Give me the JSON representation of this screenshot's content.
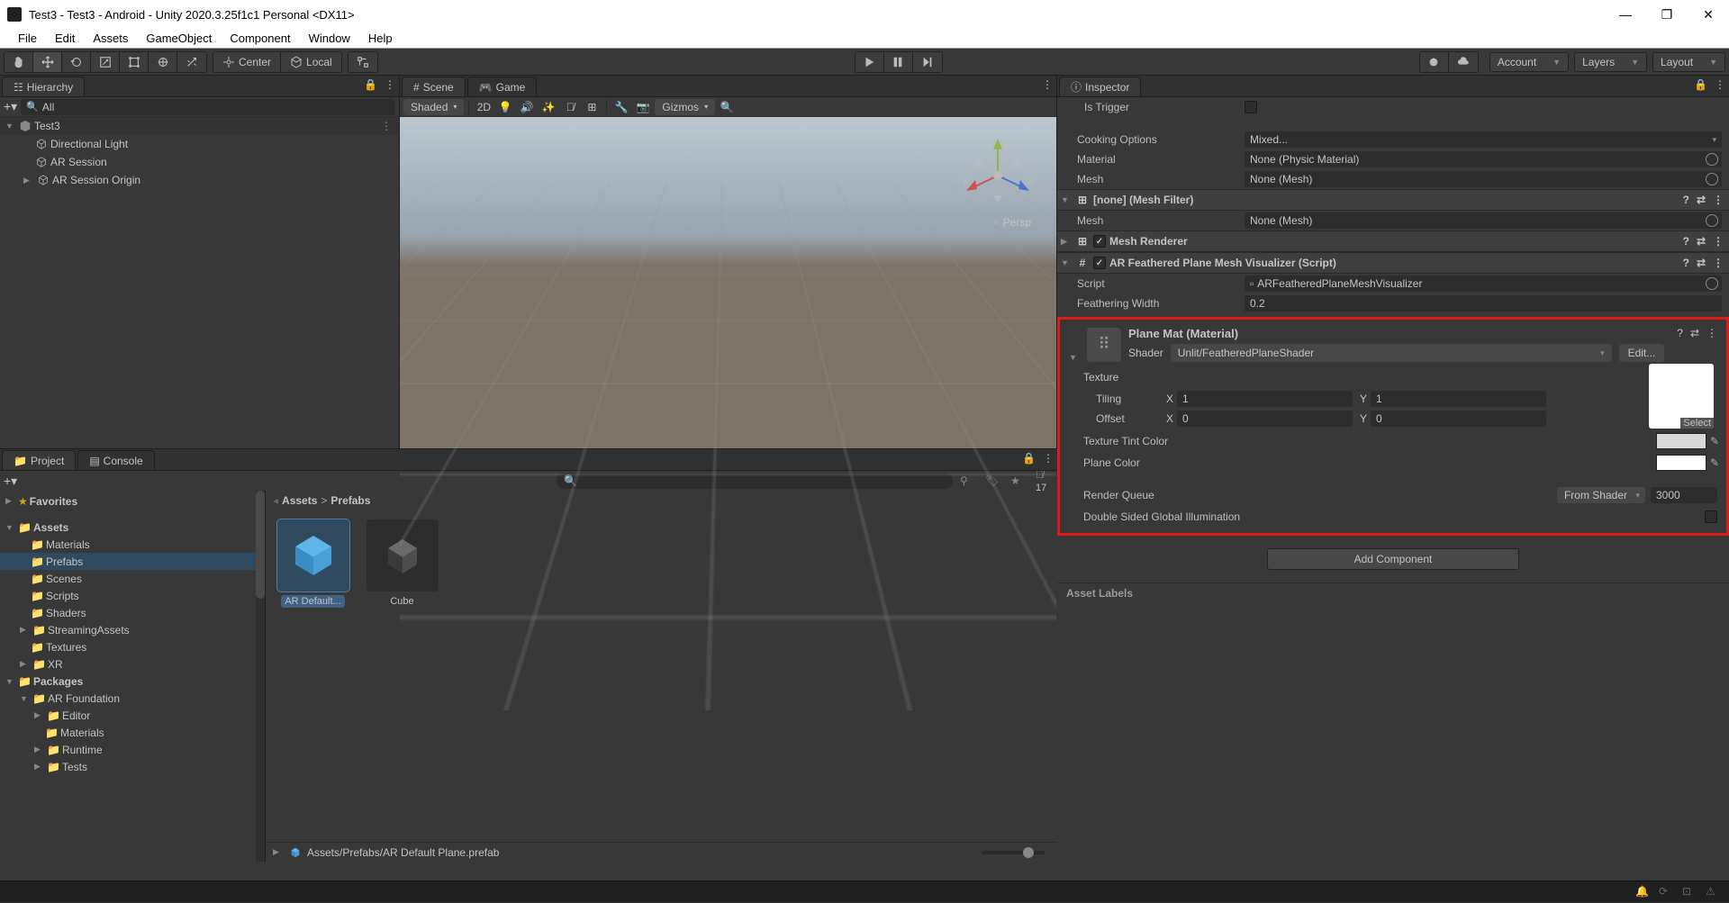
{
  "title": "Test3 - Test3 - Android - Unity 2020.3.25f1c1 Personal <DX11>",
  "menu": [
    "File",
    "Edit",
    "Assets",
    "GameObject",
    "Component",
    "Window",
    "Help"
  ],
  "toolbar": {
    "center": "Center",
    "local": "Local",
    "account": "Account",
    "layers": "Layers",
    "layout": "Layout"
  },
  "hierarchy": {
    "title": "Hierarchy",
    "search_ph": "All",
    "scene": "Test3",
    "items": [
      "Directional Light",
      "AR Session",
      "AR Session Origin"
    ]
  },
  "scene": {
    "tab_scene": "Scene",
    "tab_game": "Game",
    "draw_mode": "Shaded",
    "twod": "2D",
    "gizmos": "Gizmos",
    "persp": "Persp",
    "axes": {
      "x": "x",
      "y": "y",
      "z": "z"
    }
  },
  "project": {
    "tab_project": "Project",
    "tab_console": "Console",
    "visible_count": "17",
    "favorites": "Favorites",
    "assets": "Assets",
    "folders": [
      "Materials",
      "Prefabs",
      "Scenes",
      "Scripts",
      "Shaders",
      "StreamingAssets",
      "Textures",
      "XR"
    ],
    "packages": "Packages",
    "pkg_items": [
      "AR Foundation",
      "Editor",
      "Materials",
      "Runtime",
      "Tests"
    ],
    "breadcrumb_root": "Assets",
    "breadcrumb_sep": ">",
    "breadcrumb_leaf": "Prefabs",
    "asset1": "AR Default...",
    "asset2": "Cube",
    "footer_path": "Assets/Prefabs/AR Default Plane.prefab"
  },
  "inspector": {
    "title": "Inspector",
    "is_trigger": "Is Trigger",
    "cooking_options": "Cooking Options",
    "cooking_val": "Mixed...",
    "material_lbl": "Material",
    "material_val": "None (Physic Material)",
    "mesh_lbl": "Mesh",
    "mesh_val": "None (Mesh)",
    "comp_meshfilter": "[none] (Mesh Filter)",
    "comp_meshrenderer": "Mesh Renderer",
    "comp_feathered": "AR Feathered Plane Mesh Visualizer (Script)",
    "script_lbl": "Script",
    "script_val": "ARFeatheredPlaneMeshVisualizer",
    "feather_lbl": "Feathering Width",
    "feather_val": "0.2",
    "mat_title": "Plane Mat (Material)",
    "shader_lbl": "Shader",
    "shader_val": "Unlit/FeatheredPlaneShader",
    "edit": "Edit...",
    "texture": "Texture",
    "tiling": "Tiling",
    "offset": "Offset",
    "x": "X",
    "y": "Y",
    "til_x": "1",
    "til_y": "1",
    "off_x": "0",
    "off_y": "0",
    "select": "Select",
    "tint": "Texture Tint Color",
    "plane_color": "Plane Color",
    "render_queue": "Render Queue",
    "rq_mode": "From Shader",
    "rq_val": "3000",
    "dsgi": "Double Sided Global Illumination",
    "add_component": "Add Component",
    "asset_labels": "Asset Labels"
  }
}
